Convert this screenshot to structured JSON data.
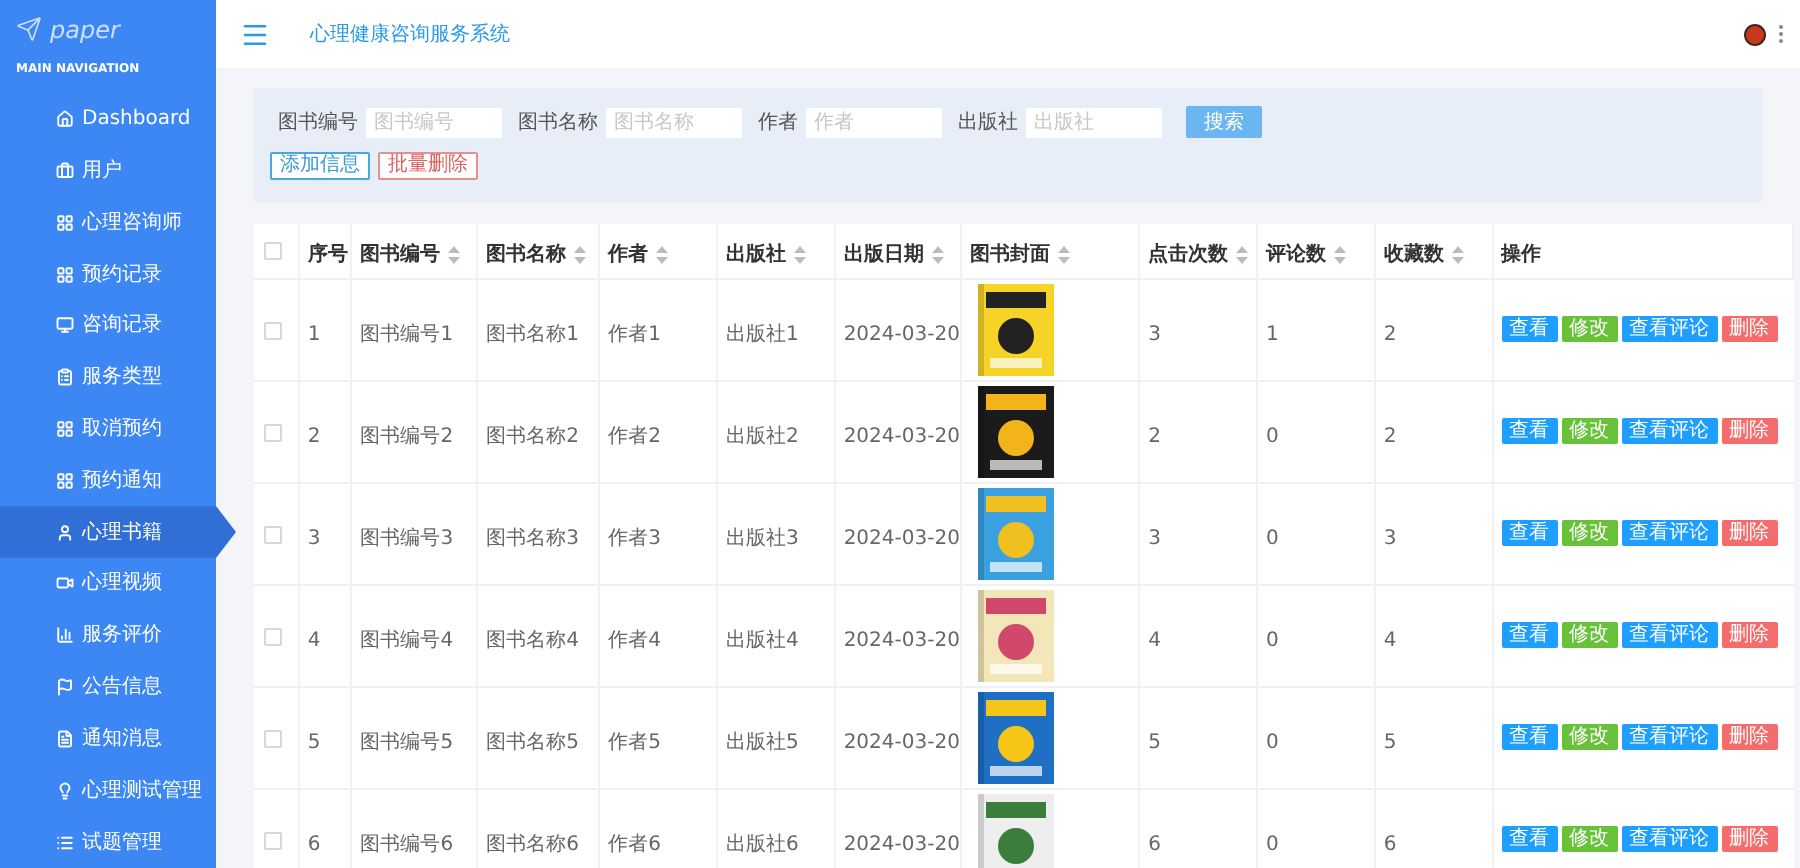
{
  "logo": "paper",
  "nav_heading": "MAIN NAVIGATION",
  "sidebar": {
    "items": [
      {
        "label": "Dashboard",
        "selected": false
      },
      {
        "label": "用户",
        "selected": false
      },
      {
        "label": "心理咨询师",
        "selected": false
      },
      {
        "label": "预约记录",
        "selected": false
      },
      {
        "label": "咨询记录",
        "selected": false
      },
      {
        "label": "服务类型",
        "selected": false
      },
      {
        "label": "取消预约",
        "selected": false
      },
      {
        "label": "预约通知",
        "selected": false
      },
      {
        "label": "心理书籍",
        "selected": true
      },
      {
        "label": "心理视频",
        "selected": false
      },
      {
        "label": "服务评价",
        "selected": false
      },
      {
        "label": "公告信息",
        "selected": false
      },
      {
        "label": "通知消息",
        "selected": false
      },
      {
        "label": "心理测试管理",
        "selected": false
      },
      {
        "label": "试题管理",
        "selected": false
      }
    ]
  },
  "header": {
    "title": "心理健康咨询服务系统"
  },
  "search": {
    "fields": [
      {
        "label": "图书编号",
        "placeholder": "图书编号"
      },
      {
        "label": "图书名称",
        "placeholder": "图书名称"
      },
      {
        "label": "作者",
        "placeholder": "作者"
      },
      {
        "label": "出版社",
        "placeholder": "出版社"
      }
    ],
    "search_button": "搜索",
    "add_button": "添加信息",
    "batch_delete_button": "批量删除"
  },
  "table": {
    "all_checked": false,
    "columns": [
      {
        "label": "序号",
        "sortable": false
      },
      {
        "label": "图书编号",
        "sortable": true
      },
      {
        "label": "图书名称",
        "sortable": true
      },
      {
        "label": "作者",
        "sortable": true
      },
      {
        "label": "出版社",
        "sortable": true
      },
      {
        "label": "出版日期",
        "sortable": true
      },
      {
        "label": "图书封面",
        "sortable": true
      },
      {
        "label": "点击次数",
        "sortable": true
      },
      {
        "label": "评论数",
        "sortable": true
      },
      {
        "label": "收藏数",
        "sortable": true
      },
      {
        "label": "操作",
        "sortable": false
      }
    ],
    "rows": [
      {
        "checked": false,
        "cells": [
          "1",
          "图书编号1",
          "图书名称1",
          "作者1",
          "出版社1",
          "2024-03-20"
        ],
        "stats": [
          "3",
          "1",
          "2"
        ],
        "actions": [
          "查看",
          "修改",
          "查看评论",
          "删除"
        ]
      },
      {
        "checked": false,
        "cells": [
          "2",
          "图书编号2",
          "图书名称2",
          "作者2",
          "出版社2",
          "2024-03-20"
        ],
        "stats": [
          "2",
          "0",
          "2"
        ],
        "actions": [
          "查看",
          "修改",
          "查看评论",
          "删除"
        ]
      },
      {
        "checked": false,
        "cells": [
          "3",
          "图书编号3",
          "图书名称3",
          "作者3",
          "出版社3",
          "2024-03-20"
        ],
        "stats": [
          "3",
          "0",
          "3"
        ],
        "actions": [
          "查看",
          "修改",
          "查看评论",
          "删除"
        ]
      },
      {
        "checked": false,
        "cells": [
          "4",
          "图书编号4",
          "图书名称4",
          "作者4",
          "出版社4",
          "2024-03-20"
        ],
        "stats": [
          "4",
          "0",
          "4"
        ],
        "actions": [
          "查看",
          "修改",
          "查看评论",
          "删除"
        ]
      },
      {
        "checked": false,
        "cells": [
          "5",
          "图书编号5",
          "图书名称5",
          "作者5",
          "出版社5",
          "2024-03-20"
        ],
        "stats": [
          "5",
          "0",
          "5"
        ],
        "actions": [
          "查看",
          "修改",
          "查看评论",
          "删除"
        ]
      },
      {
        "checked": false,
        "cells": [
          "6",
          "图书编号6",
          "图书名称6",
          "作者6",
          "出版社6",
          "2024-03-20"
        ],
        "stats": [
          "6",
          "0",
          "6"
        ],
        "actions": [
          "查看",
          "修改",
          "查看评论",
          "删除"
        ]
      }
    ]
  }
}
